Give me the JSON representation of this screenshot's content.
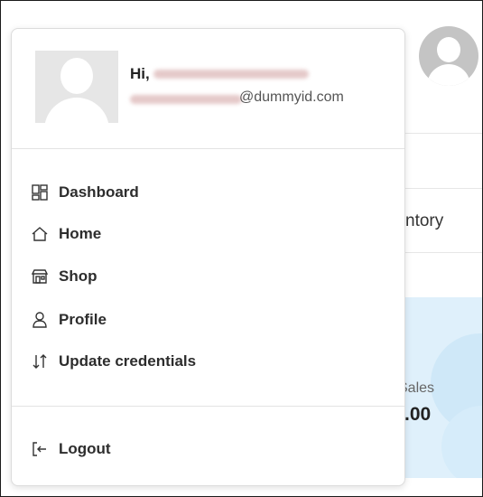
{
  "user": {
    "greeting": "Hi,",
    "email_domain": "@dummyid.com"
  },
  "menu": {
    "items": [
      {
        "label": "Dashboard",
        "icon": "dashboard-icon"
      },
      {
        "label": "Home",
        "icon": "home-icon"
      },
      {
        "label": "Shop",
        "icon": "shop-icon"
      },
      {
        "label": "Profile",
        "icon": "profile-icon"
      },
      {
        "label": "Update credentials",
        "icon": "update-credentials-icon"
      }
    ],
    "logout": {
      "label": "Logout",
      "icon": "logout-icon"
    }
  },
  "background": {
    "inventory_fragment": "ntory",
    "sales_label": "Sales",
    "sales_amount_fragment": ").00"
  }
}
